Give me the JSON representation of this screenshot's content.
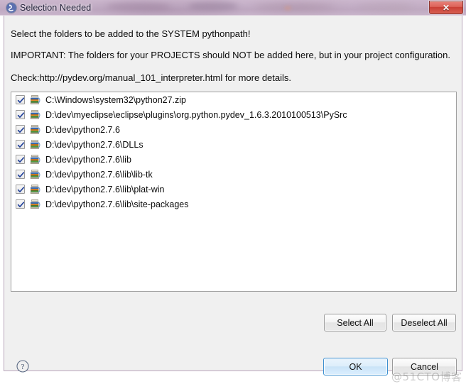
{
  "window": {
    "title": "Selection Needed",
    "icon": "pydev-app-icon",
    "close_label": "✕",
    "titlebar_color": "#c3aec6",
    "client_bg": "#f0f0f0"
  },
  "messages": {
    "line1": "Select the folders to be added to the SYSTEM pythonpath!",
    "line2": "IMPORTANT: The folders for your PROJECTS should NOT be added here, but in your project configuration.",
    "line3": "Check:http://pydev.org/manual_101_interpreter.html for more details."
  },
  "list": {
    "items": [
      {
        "label": "C:\\Windows\\system32\\python27.zip",
        "checked": true,
        "icon": "library-icon"
      },
      {
        "label": "D:\\dev\\myeclipse\\eclipse\\plugins\\org.python.pydev_1.6.3.2010100513\\PySrc",
        "checked": true,
        "icon": "library-icon"
      },
      {
        "label": "D:\\dev\\python2.7.6",
        "checked": true,
        "icon": "library-icon"
      },
      {
        "label": "D:\\dev\\python2.7.6\\DLLs",
        "checked": true,
        "icon": "library-icon"
      },
      {
        "label": "D:\\dev\\python2.7.6\\lib",
        "checked": true,
        "icon": "library-icon"
      },
      {
        "label": "D:\\dev\\python2.7.6\\lib\\lib-tk",
        "checked": true,
        "icon": "library-icon"
      },
      {
        "label": "D:\\dev\\python2.7.6\\lib\\plat-win",
        "checked": true,
        "icon": "library-icon"
      },
      {
        "label": "D:\\dev\\python2.7.6\\lib\\site-packages",
        "checked": true,
        "icon": "library-icon"
      }
    ]
  },
  "buttons": {
    "select_all": "Select All",
    "deselect_all": "Deselect All",
    "ok": "OK",
    "cancel": "Cancel"
  },
  "help": {
    "icon": "help-question-icon"
  },
  "watermark": {
    "text": "@51CTO博客"
  }
}
